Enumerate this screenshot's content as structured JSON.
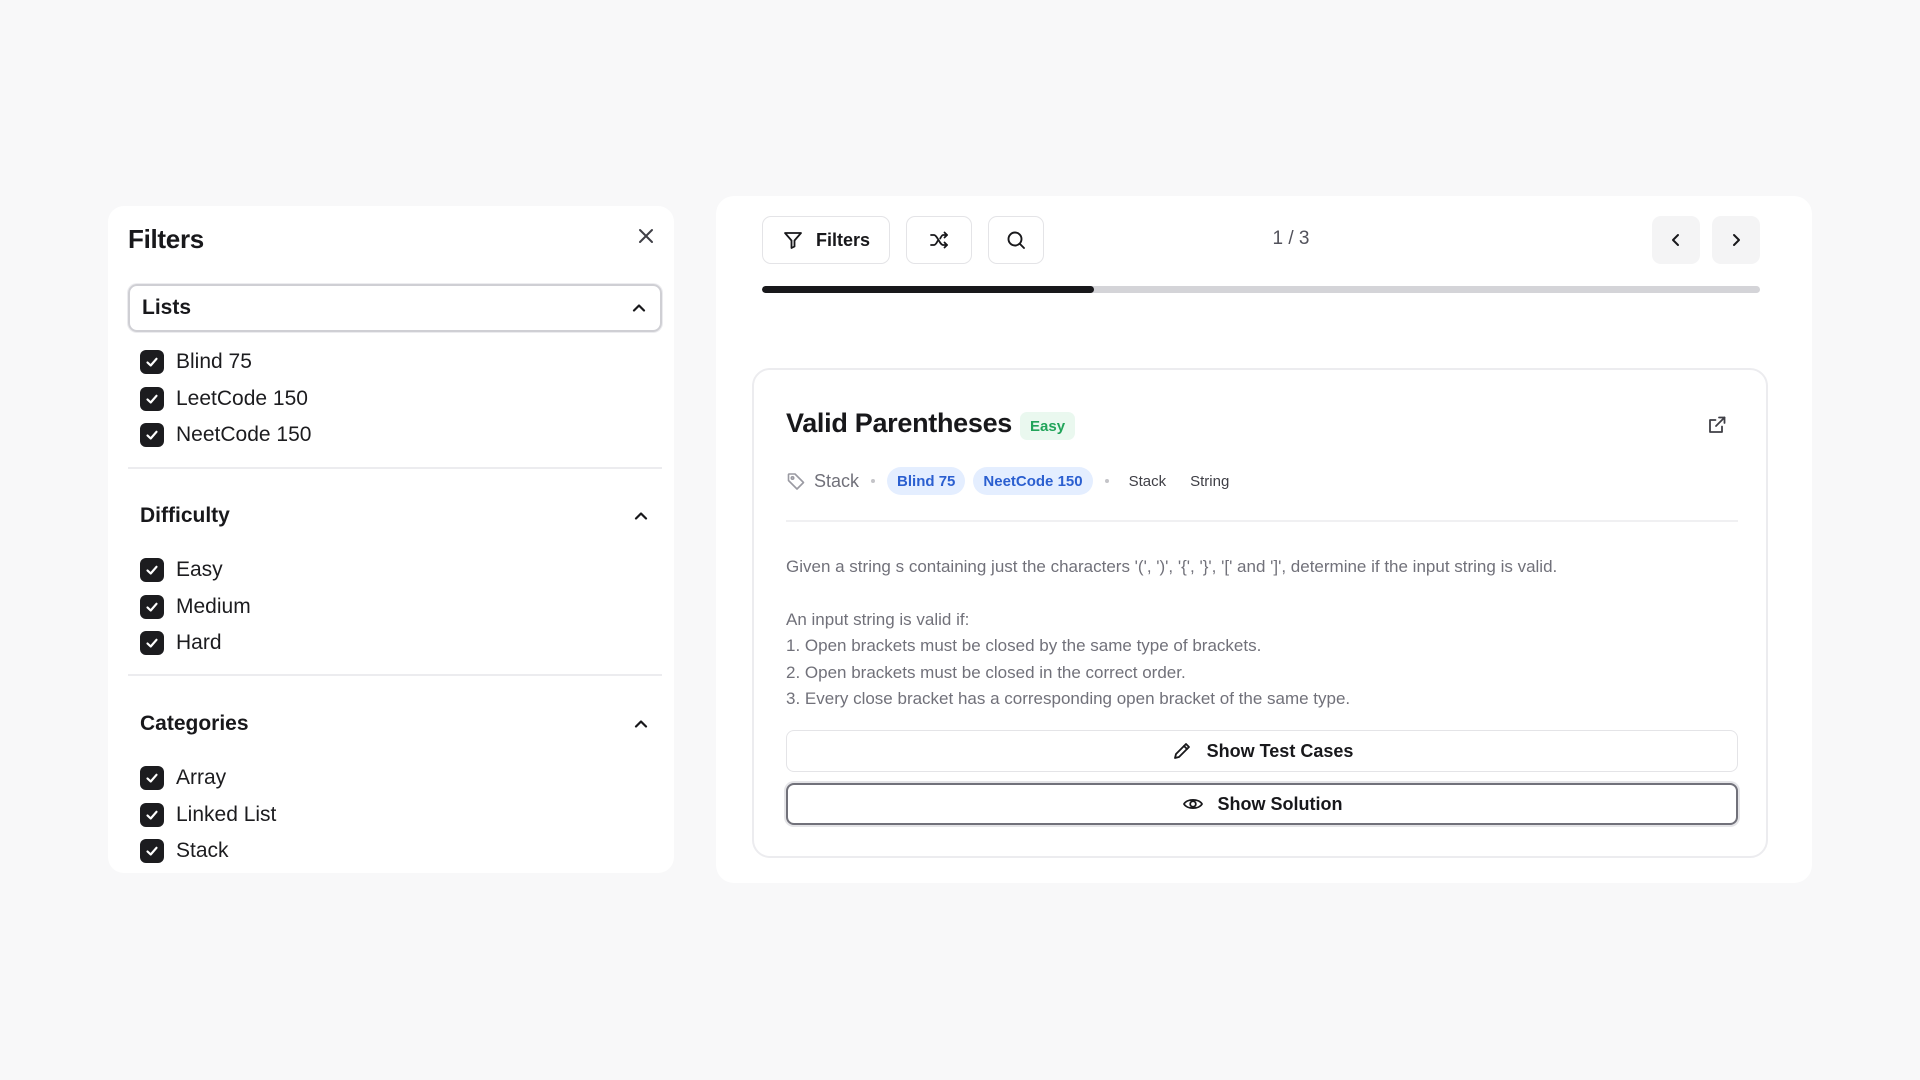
{
  "filters": {
    "title": "Filters",
    "sections": [
      {
        "label": "Lists",
        "expanded": true,
        "options": [
          {
            "label": "Blind 75",
            "checked": true
          },
          {
            "label": "LeetCode 150",
            "checked": true
          },
          {
            "label": "NeetCode 150",
            "checked": true
          }
        ]
      },
      {
        "label": "Difficulty",
        "expanded": true,
        "options": [
          {
            "label": "Easy",
            "checked": true
          },
          {
            "label": "Medium",
            "checked": true
          },
          {
            "label": "Hard",
            "checked": true
          }
        ]
      },
      {
        "label": "Categories",
        "expanded": true,
        "options": [
          {
            "label": "Array",
            "checked": true
          },
          {
            "label": "Linked List",
            "checked": true
          },
          {
            "label": "Stack",
            "checked": true
          }
        ]
      }
    ]
  },
  "toolbar": {
    "filters_label": "Filters",
    "counter": "1 / 3",
    "progress_fraction": 0.333
  },
  "problem": {
    "title": "Valid Parentheses",
    "difficulty": "Easy",
    "category": "Stack",
    "list_tags": [
      "Blind 75",
      "NeetCode 150"
    ],
    "topic_tags": [
      "Stack",
      "String"
    ],
    "description": [
      "Given a string s containing just the characters '(', ')', '{', '}', '[' and ']', determine if the input string is valid.",
      "",
      "An input string is valid if:",
      "1. Open brackets must be closed by the same type of brackets.",
      "2. Open brackets must be closed in the correct order.",
      "3. Every close bracket has a corresponding open bracket of the same type."
    ],
    "show_test_cases_label": "Show Test Cases",
    "show_solution_label": "Show Solution"
  },
  "colors": {
    "background": "#f8f8f9",
    "accent_dark": "#18181b",
    "easy_green": "#22a45a",
    "tag_blue": "#2b5fd0"
  },
  "icons": {
    "close": "close-icon",
    "chevron": "chevron-up-icon",
    "filter": "filter-icon",
    "shuffle": "shuffle-icon",
    "search": "search-icon",
    "prev": "chevron-left-icon",
    "next": "chevron-right-icon",
    "external": "external-link-icon",
    "tag": "tag-icon",
    "edit": "pencil-icon",
    "view": "eye-icon"
  }
}
